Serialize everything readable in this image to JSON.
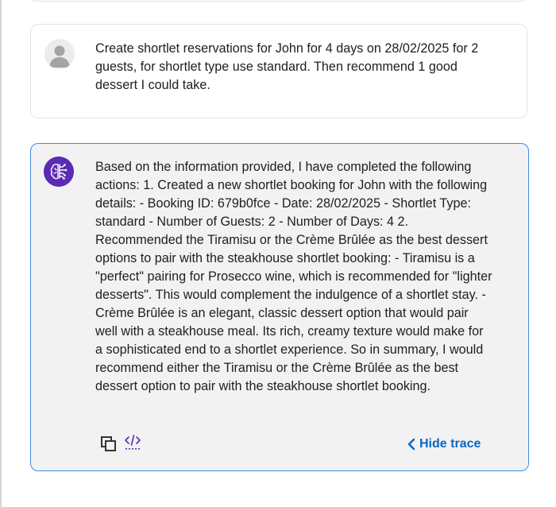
{
  "conversation": {
    "user_message": {
      "avatar_icon": "user-avatar-icon",
      "text": "Create shortlet reservations for John for 4 days on 28/02/2025 for 2 guests, for shortlet type use standard. Then recommend 1 good dessert I could take."
    },
    "assistant_message": {
      "avatar_icon": "ai-brain-icon",
      "text": "Based on the information provided, I have completed the following actions: 1. Created a new shortlet booking for John with the following details: - Booking ID: 679b0fce - Date: 28/02/2025 - Shortlet Type: standard - Number of Guests: 2 - Number of Days: 4 2. Recommended the Tiramisu or the Crème Brûlée as the best dessert options to pair with the steakhouse shortlet booking: - Tiramisu is a \"perfect\" pairing for Prosecco wine, which is recommended for \"lighter desserts\". This would complement the indulgence of a shortlet stay. - Crème Brûlée is an elegant, classic dessert option that would pair well with a steakhouse meal. Its rich, creamy texture would make for a sophisticated end to a shortlet experience. So in summary, I would recommend either the Tiramisu or the Crème Brûlée as the best dessert option to pair with the steakhouse shortlet booking.",
      "actions": {
        "copy_icon": "copy-icon",
        "code_icon": "code-trace-icon",
        "hide_trace_label": "Hide trace"
      }
    }
  },
  "colors": {
    "accent": "#0b66c6",
    "bot_border": "#3d8de0",
    "bot_background": "#f2f2f2",
    "bot_avatar": "#5b2bb5",
    "text": "#202020"
  }
}
